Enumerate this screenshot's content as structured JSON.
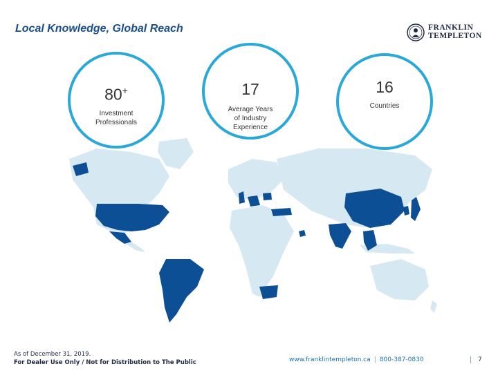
{
  "title": "Local Knowledge, Global Reach",
  "logo": {
    "line1": "FRANKLIN",
    "line2": "TEMPLETON"
  },
  "stats": [
    {
      "value": "80",
      "superscript": "+",
      "label": "Investment\nProfessionals"
    },
    {
      "value": "17",
      "label": "Average Years\nof Industry\nExperience"
    },
    {
      "value": "16",
      "label": "Countries"
    }
  ],
  "map": {
    "land_color": "#d6e9f3",
    "highlight_color": "#0d4f94"
  },
  "footer": {
    "date": "As of December 31, 2019.",
    "disclaimer": "For Dealer Use Only / Not for Distribution to The Public",
    "website": "www.franklintempleton.ca",
    "phone": "800-387-0830",
    "page": "7"
  },
  "colors": {
    "title": "#1a4e8a",
    "circle_border": "#2aa8d8"
  }
}
